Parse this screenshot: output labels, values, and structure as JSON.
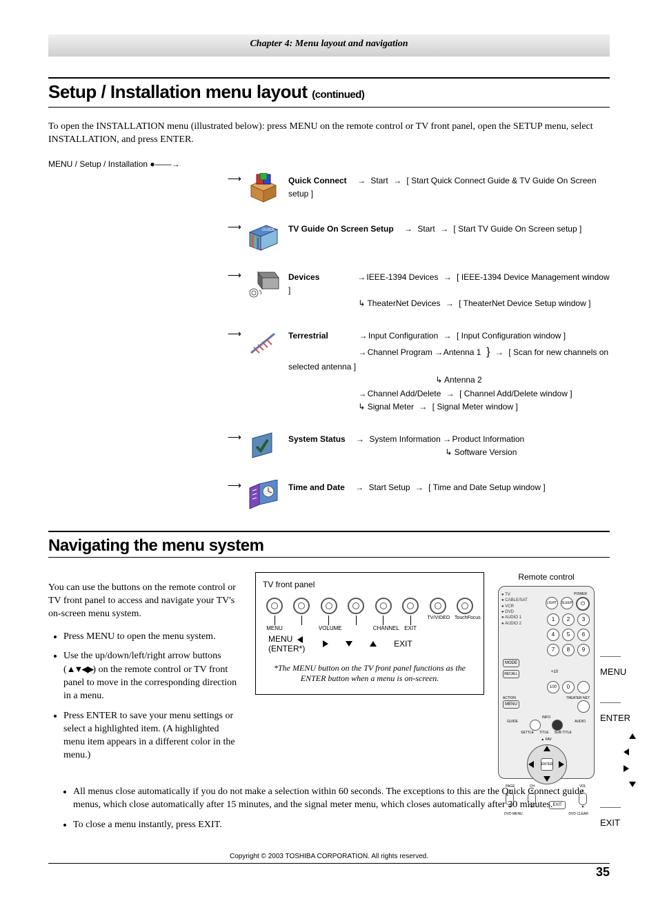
{
  "chapter_header": "Chapter 4: Menu layout and navigation",
  "h1_main": "Setup / Installation menu layout ",
  "h1_cont": "(continued)",
  "intro": "To open the INSTALLATION menu (illustrated below): press MENU on the remote control or TV front panel, open the SETUP menu, select INSTALLATION, and press ENTER.",
  "breadcrumb": "MENU / Setup / Installation",
  "menu": {
    "quick_connect": {
      "label": "Quick Connect",
      "sub1": "Start",
      "desc": "[ Start Quick Connect Guide & TV Guide On Screen setup ]"
    },
    "tvguide": {
      "label": "TV Guide On Screen Setup",
      "sub1": "Start",
      "desc": "[ Start TV Guide On Screen setup ]"
    },
    "devices": {
      "label": "Devices",
      "line1a": "IEEE-1394 Devices",
      "line1b": "[ IEEE-1394 Device Management window ]",
      "line2a": "TheaterNet Devices",
      "line2b": "[ TheaterNet Device Setup window ]"
    },
    "terrestrial": {
      "label": "Terrestrial",
      "l1a": "Input Configuration",
      "l1b": "[ Input Configuration window ]",
      "l2a": "Channel Program",
      "l2_ant1": "Antenna 1",
      "l2_ant2": "Antenna 2",
      "l2_desc": "[ Scan for new channels on selected antenna ]",
      "l3a": "Channel Add/Delete",
      "l3b": "[ Channel Add/Delete window ]",
      "l4a": "Signal Meter",
      "l4b": "[ Signal Meter window ]"
    },
    "status": {
      "label": "System Status",
      "l1": "System Information",
      "l1a": "Product Information",
      "l1b": "Software Version"
    },
    "timedate": {
      "label": "Time and Date",
      "l1": "Start Setup",
      "l1b": "[ Time and Date Setup window ]"
    }
  },
  "h2": "Navigating the menu system",
  "nav_intro": "You can use the buttons on the remote control or TV front panel to access and navigate your TV's on-screen menu system.",
  "bullets": {
    "b1": "Press MENU to open the menu system.",
    "b2a": "Use the up/down/left/right arrow buttons (",
    "b2b": ") on the remote control or TV front panel to move in the corresponding direction in a menu.",
    "b3": "Press ENTER to save your menu settings or select a highlighted item. (A highlighted menu item appears in a different color in the menu.)",
    "b4": "All menus close automatically if you do not make a selection within 60 seconds. The exceptions to this are the Quick Connect guide menus, which close automatically after 15 minutes, and the signal meter menu, which closes automatically after 30 minutes.",
    "b5": "To close a menu instantly, press EXIT."
  },
  "tv_panel": {
    "title": "TV front panel",
    "k1": "MENU",
    "k2": "VOLUME",
    "k3": "CHANNEL",
    "k4": "EXIT",
    "k5": "TV/VIDEO",
    "k6": "TouchFocus",
    "l_menu": "MENU",
    "l_enter": "(ENTER*)",
    "l_exit": "EXIT",
    "note": "*The MENU button on the TV front panel functions as the ENTER button when a menu is on-screen."
  },
  "remote": {
    "title": "Remote control",
    "menu": "MENU",
    "enter": "ENTER",
    "exit": "EXIT",
    "side": {
      "tv": "TV",
      "cable": "CABLE/SAT",
      "vcr": "VCR",
      "dvd": "DVD",
      "a1": "AUDIO 1",
      "a2": "AUDIO 2"
    },
    "btn": {
      "light": "LIGHT",
      "sleep": "SLEEP",
      "power": "POWER",
      "mode": "MODE",
      "recall": "RECALL",
      "p100": "100",
      "action": "ACTION",
      "menu": "MENU",
      "info": "INFO",
      "guide": "GUIDE",
      "title": "TITLE",
      "subtitle": "SUB TITLE",
      "audio": "AUDIO",
      "settle": "SETTLE",
      "theater": "THEATER NET",
      "enter": "ENTER",
      "fav": "FAV",
      "page": "PAGE",
      "ch": "CH",
      "vol": "VOL",
      "exit_btn": "EXIT",
      "dvdmenu": "DVD MENU",
      "dvdclear": "DVD CLEAR"
    }
  },
  "copyright": "Copyright © 2003 TOSHIBA CORPORATION. All rights reserved.",
  "page_num": "35"
}
